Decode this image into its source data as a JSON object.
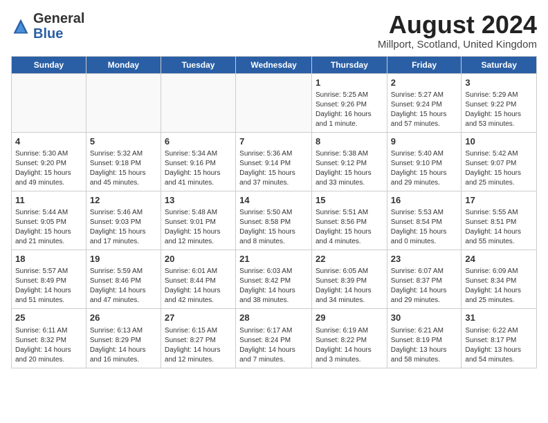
{
  "header": {
    "logo_general": "General",
    "logo_blue": "Blue",
    "month_title": "August 2024",
    "location": "Millport, Scotland, United Kingdom"
  },
  "weekdays": [
    "Sunday",
    "Monday",
    "Tuesday",
    "Wednesday",
    "Thursday",
    "Friday",
    "Saturday"
  ],
  "weeks": [
    [
      {
        "day": "",
        "info": ""
      },
      {
        "day": "",
        "info": ""
      },
      {
        "day": "",
        "info": ""
      },
      {
        "day": "",
        "info": ""
      },
      {
        "day": "1",
        "info": "Sunrise: 5:25 AM\nSunset: 9:26 PM\nDaylight: 16 hours\nand 1 minute."
      },
      {
        "day": "2",
        "info": "Sunrise: 5:27 AM\nSunset: 9:24 PM\nDaylight: 15 hours\nand 57 minutes."
      },
      {
        "day": "3",
        "info": "Sunrise: 5:29 AM\nSunset: 9:22 PM\nDaylight: 15 hours\nand 53 minutes."
      }
    ],
    [
      {
        "day": "4",
        "info": "Sunrise: 5:30 AM\nSunset: 9:20 PM\nDaylight: 15 hours\nand 49 minutes."
      },
      {
        "day": "5",
        "info": "Sunrise: 5:32 AM\nSunset: 9:18 PM\nDaylight: 15 hours\nand 45 minutes."
      },
      {
        "day": "6",
        "info": "Sunrise: 5:34 AM\nSunset: 9:16 PM\nDaylight: 15 hours\nand 41 minutes."
      },
      {
        "day": "7",
        "info": "Sunrise: 5:36 AM\nSunset: 9:14 PM\nDaylight: 15 hours\nand 37 minutes."
      },
      {
        "day": "8",
        "info": "Sunrise: 5:38 AM\nSunset: 9:12 PM\nDaylight: 15 hours\nand 33 minutes."
      },
      {
        "day": "9",
        "info": "Sunrise: 5:40 AM\nSunset: 9:10 PM\nDaylight: 15 hours\nand 29 minutes."
      },
      {
        "day": "10",
        "info": "Sunrise: 5:42 AM\nSunset: 9:07 PM\nDaylight: 15 hours\nand 25 minutes."
      }
    ],
    [
      {
        "day": "11",
        "info": "Sunrise: 5:44 AM\nSunset: 9:05 PM\nDaylight: 15 hours\nand 21 minutes."
      },
      {
        "day": "12",
        "info": "Sunrise: 5:46 AM\nSunset: 9:03 PM\nDaylight: 15 hours\nand 17 minutes."
      },
      {
        "day": "13",
        "info": "Sunrise: 5:48 AM\nSunset: 9:01 PM\nDaylight: 15 hours\nand 12 minutes."
      },
      {
        "day": "14",
        "info": "Sunrise: 5:50 AM\nSunset: 8:58 PM\nDaylight: 15 hours\nand 8 minutes."
      },
      {
        "day": "15",
        "info": "Sunrise: 5:51 AM\nSunset: 8:56 PM\nDaylight: 15 hours\nand 4 minutes."
      },
      {
        "day": "16",
        "info": "Sunrise: 5:53 AM\nSunset: 8:54 PM\nDaylight: 15 hours\nand 0 minutes."
      },
      {
        "day": "17",
        "info": "Sunrise: 5:55 AM\nSunset: 8:51 PM\nDaylight: 14 hours\nand 55 minutes."
      }
    ],
    [
      {
        "day": "18",
        "info": "Sunrise: 5:57 AM\nSunset: 8:49 PM\nDaylight: 14 hours\nand 51 minutes."
      },
      {
        "day": "19",
        "info": "Sunrise: 5:59 AM\nSunset: 8:46 PM\nDaylight: 14 hours\nand 47 minutes."
      },
      {
        "day": "20",
        "info": "Sunrise: 6:01 AM\nSunset: 8:44 PM\nDaylight: 14 hours\nand 42 minutes."
      },
      {
        "day": "21",
        "info": "Sunrise: 6:03 AM\nSunset: 8:42 PM\nDaylight: 14 hours\nand 38 minutes."
      },
      {
        "day": "22",
        "info": "Sunrise: 6:05 AM\nSunset: 8:39 PM\nDaylight: 14 hours\nand 34 minutes."
      },
      {
        "day": "23",
        "info": "Sunrise: 6:07 AM\nSunset: 8:37 PM\nDaylight: 14 hours\nand 29 minutes."
      },
      {
        "day": "24",
        "info": "Sunrise: 6:09 AM\nSunset: 8:34 PM\nDaylight: 14 hours\nand 25 minutes."
      }
    ],
    [
      {
        "day": "25",
        "info": "Sunrise: 6:11 AM\nSunset: 8:32 PM\nDaylight: 14 hours\nand 20 minutes."
      },
      {
        "day": "26",
        "info": "Sunrise: 6:13 AM\nSunset: 8:29 PM\nDaylight: 14 hours\nand 16 minutes."
      },
      {
        "day": "27",
        "info": "Sunrise: 6:15 AM\nSunset: 8:27 PM\nDaylight: 14 hours\nand 12 minutes."
      },
      {
        "day": "28",
        "info": "Sunrise: 6:17 AM\nSunset: 8:24 PM\nDaylight: 14 hours\nand 7 minutes."
      },
      {
        "day": "29",
        "info": "Sunrise: 6:19 AM\nSunset: 8:22 PM\nDaylight: 14 hours\nand 3 minutes."
      },
      {
        "day": "30",
        "info": "Sunrise: 6:21 AM\nSunset: 8:19 PM\nDaylight: 13 hours\nand 58 minutes."
      },
      {
        "day": "31",
        "info": "Sunrise: 6:22 AM\nSunset: 8:17 PM\nDaylight: 13 hours\nand 54 minutes."
      }
    ]
  ]
}
